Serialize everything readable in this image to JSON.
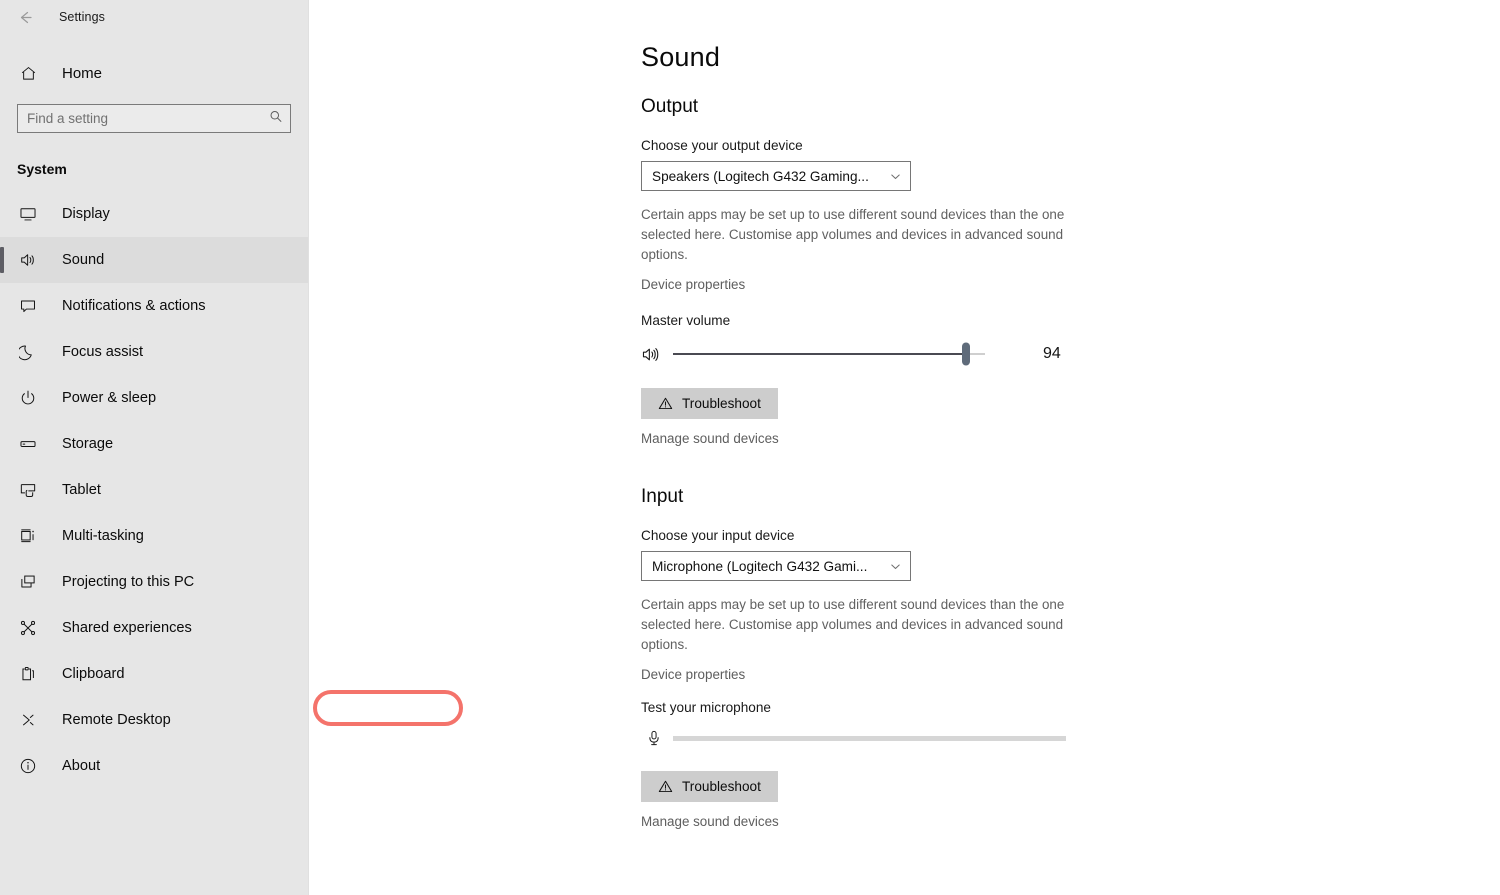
{
  "window": {
    "title": "Settings",
    "back_icon": "back-arrow-icon"
  },
  "sidebar": {
    "home_label": "Home",
    "home_icon": "home-icon",
    "search": {
      "placeholder": "Find a setting",
      "value": "",
      "icon": "search-icon"
    },
    "group_title": "System",
    "selected_item": "Sound",
    "accent_color": "#5d5d64",
    "items": [
      {
        "label": "Display",
        "icon": "monitor-icon",
        "selected": false
      },
      {
        "label": "Sound",
        "icon": "speaker-icon",
        "selected": true
      },
      {
        "label": "Notifications & actions",
        "icon": "notification-icon",
        "selected": false
      },
      {
        "label": "Focus assist",
        "icon": "moon-icon",
        "selected": false
      },
      {
        "label": "Power & sleep",
        "icon": "power-icon",
        "selected": false
      },
      {
        "label": "Storage",
        "icon": "drive-icon",
        "selected": false
      },
      {
        "label": "Tablet",
        "icon": "tablet-icon",
        "selected": false
      },
      {
        "label": "Multi-tasking",
        "icon": "multitasking-icon",
        "selected": false
      },
      {
        "label": "Projecting to this PC",
        "icon": "project-icon",
        "selected": false
      },
      {
        "label": "Shared experiences",
        "icon": "share-nodes-icon",
        "selected": false
      },
      {
        "label": "Clipboard",
        "icon": "clipboard-icon",
        "selected": false
      },
      {
        "label": "Remote Desktop",
        "icon": "remote-desktop-icon",
        "selected": false
      },
      {
        "label": "About",
        "icon": "info-icon",
        "selected": false
      }
    ]
  },
  "main": {
    "page_title": "Sound",
    "output": {
      "heading": "Output",
      "device_label": "Choose your output device",
      "device_value": "Speakers (Logitech G432 Gaming...",
      "helper_text": "Certain apps may be set up to use different sound devices than the one selected here. Customise app volumes and devices in advanced sound options.",
      "device_properties_link": "Device properties",
      "volume_label": "Master volume",
      "volume_value": "94",
      "volume_percent": 94,
      "troubleshoot_label": "Troubleshoot",
      "manage_link": "Manage sound devices"
    },
    "input": {
      "heading": "Input",
      "device_label": "Choose your input device",
      "device_value": "Microphone (Logitech G432 Gami...",
      "helper_text": "Certain apps may be set up to use different sound devices than the one selected here. Customise app volumes and devices in advanced sound options.",
      "device_properties_link": "Device properties",
      "test_label": "Test your microphone",
      "test_level_percent": 0,
      "troubleshoot_label": "Troubleshoot",
      "manage_link": "Manage sound devices"
    }
  },
  "annotation": {
    "target": "Device properties",
    "color": "#f4736b",
    "shape": "ellipse-outline"
  }
}
